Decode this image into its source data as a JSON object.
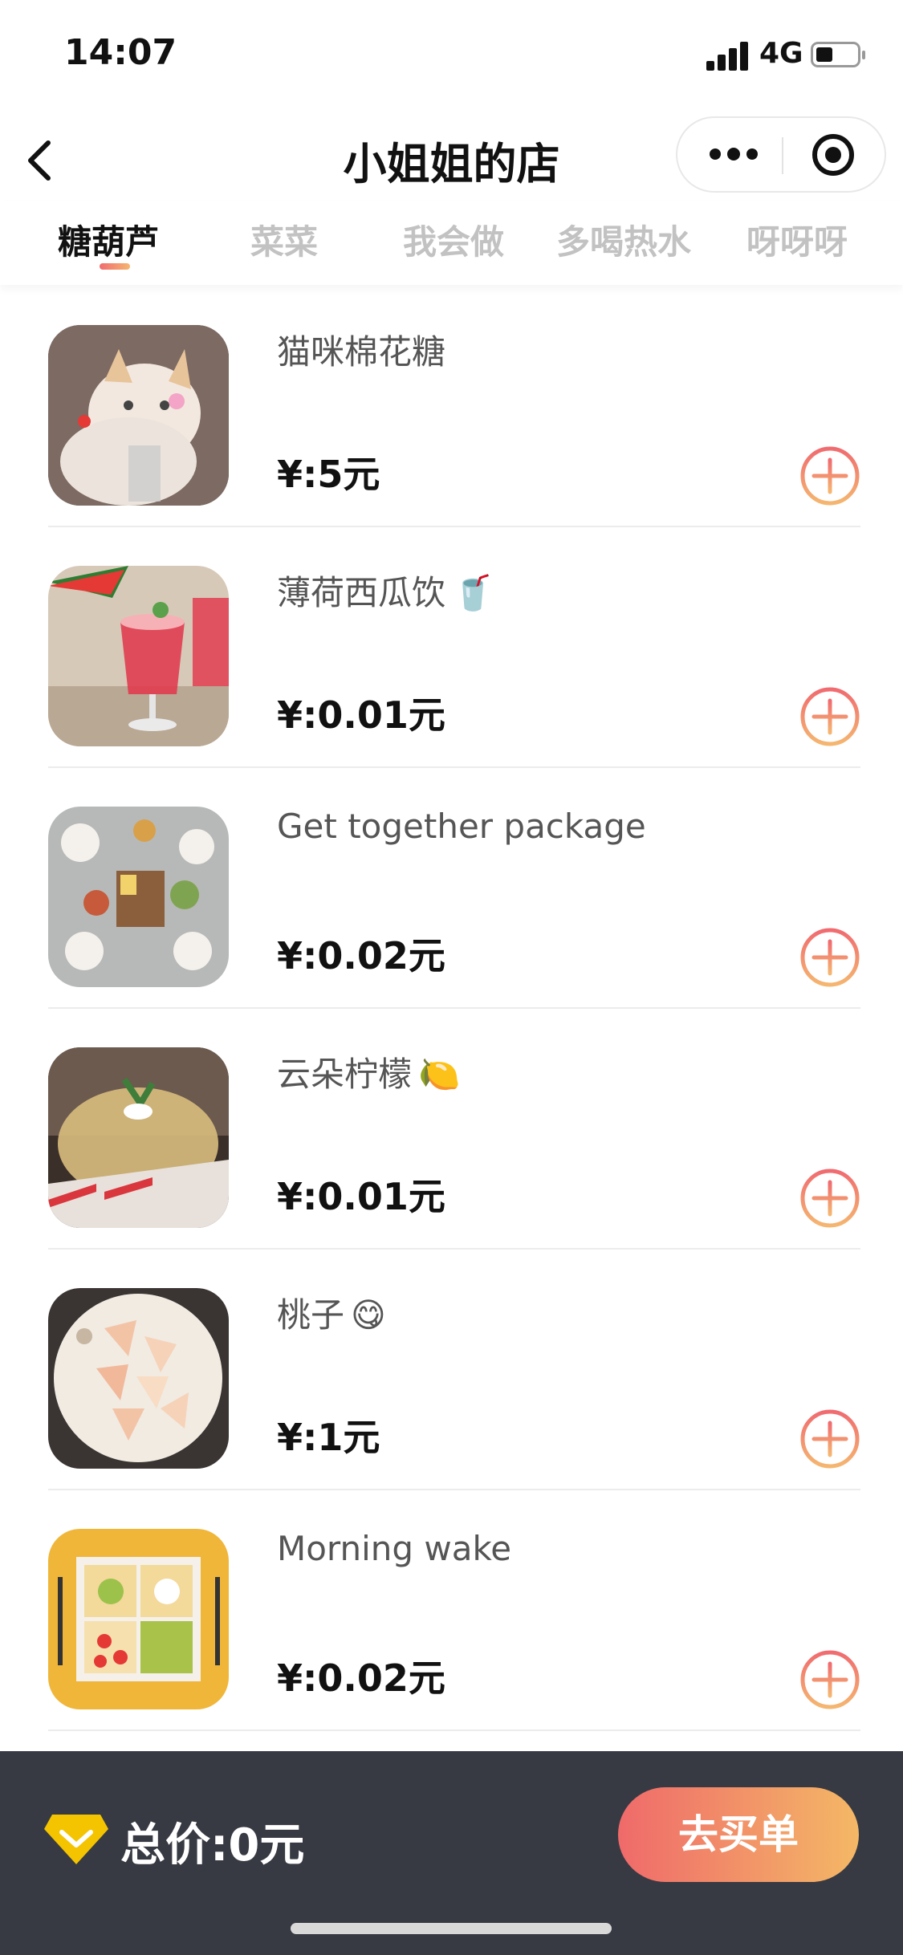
{
  "status_bar": {
    "time": "14:07",
    "network": "4G"
  },
  "nav": {
    "title": "小姐姐的店"
  },
  "tabs": [
    {
      "label": "糖葫芦",
      "active": true
    },
    {
      "label": "菜菜",
      "active": false
    },
    {
      "label": "我会做",
      "active": false
    },
    {
      "label": "多喝热水",
      "active": false
    },
    {
      "label": "呀呀呀",
      "active": false
    }
  ],
  "items": [
    {
      "name": "猫咪棉花糖",
      "emoji": "",
      "price": "¥:5元",
      "image": "cat-photo"
    },
    {
      "name": "薄荷西瓜饮",
      "emoji": "🥤",
      "price": "¥:0.01元",
      "image": "watermelon-drink-photo"
    },
    {
      "name": "Get together package",
      "emoji": "",
      "price": "¥:0.02元",
      "image": "party-table-photo"
    },
    {
      "name": "云朵柠檬",
      "emoji": "🍋",
      "price": "¥:0.01元",
      "image": "lemon-dessert-photo"
    },
    {
      "name": "桃子",
      "emoji": "😋",
      "price": "¥:1元",
      "image": "peach-plate-photo"
    },
    {
      "name": "Morning wake",
      "emoji": "",
      "price": "¥:0.02元",
      "image": "toast-breakfast-photo"
    }
  ],
  "footer": {
    "total": "总价:0元",
    "checkout_label": "去买单"
  },
  "colors": {
    "accent_start": "#f06b70",
    "accent_end": "#f5b670",
    "footer_bg": "#383a43"
  }
}
